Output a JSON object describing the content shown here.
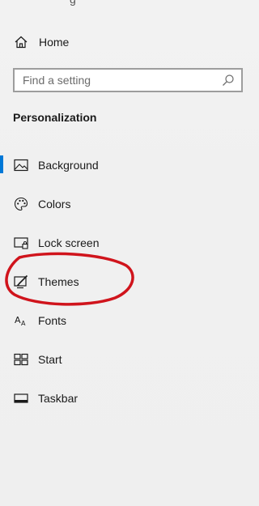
{
  "window": {
    "title_fragment": "g"
  },
  "home": {
    "label": "Home",
    "icon": "home-icon"
  },
  "search": {
    "placeholder": "Find a setting",
    "icon": "search-icon"
  },
  "section": {
    "title": "Personalization"
  },
  "nav": {
    "items": [
      {
        "label": "Background",
        "icon": "background-image-icon",
        "selected": true
      },
      {
        "label": "Colors",
        "icon": "palette-icon",
        "selected": false
      },
      {
        "label": "Lock screen",
        "icon": "lock-screen-icon",
        "selected": false
      },
      {
        "label": "Themes",
        "icon": "themes-icon",
        "selected": false
      },
      {
        "label": "Fonts",
        "icon": "fonts-icon",
        "selected": false
      },
      {
        "label": "Start",
        "icon": "start-tiles-icon",
        "selected": false
      },
      {
        "label": "Taskbar",
        "icon": "taskbar-icon",
        "selected": false
      }
    ]
  },
  "colors": {
    "accent": "#0078d7",
    "annotation": "#d0141c",
    "background": "#f0f0f0"
  }
}
